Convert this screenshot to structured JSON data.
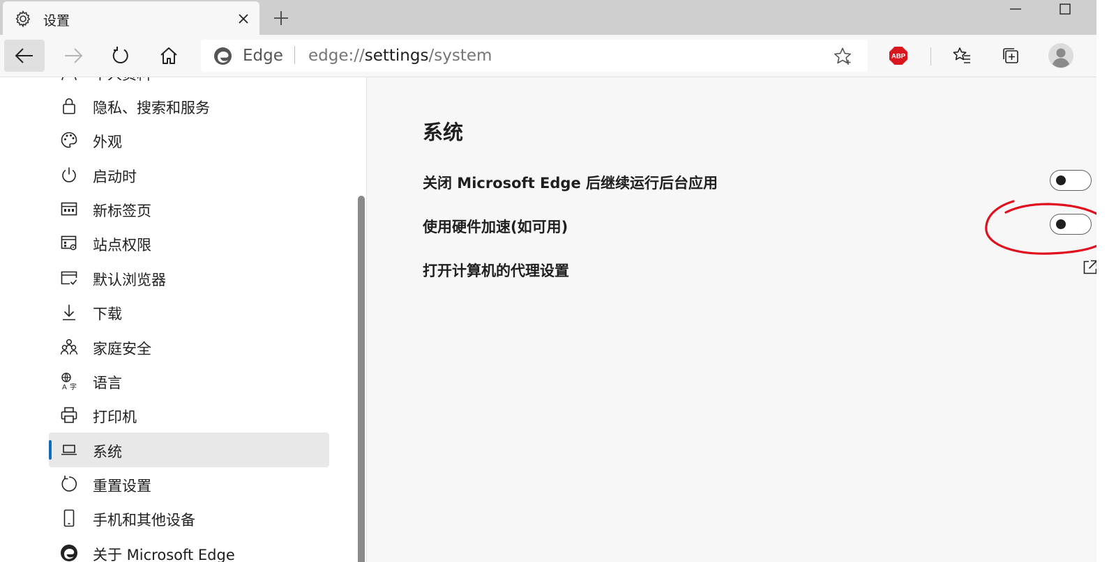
{
  "tab": {
    "title": "设置"
  },
  "address": {
    "site_name": "Edge",
    "url_prefix": "edge://",
    "url_highlight": "settings",
    "url_suffix": "/system"
  },
  "sidebar": {
    "items": [
      {
        "label": "个人资料",
        "icon": "person-icon",
        "selected": false
      },
      {
        "label": "隐私、搜索和服务",
        "icon": "lock-icon",
        "selected": false
      },
      {
        "label": "外观",
        "icon": "palette-icon",
        "selected": false
      },
      {
        "label": "启动时",
        "icon": "power-icon",
        "selected": false
      },
      {
        "label": "新标签页",
        "icon": "new-tab-page-icon",
        "selected": false
      },
      {
        "label": "站点权限",
        "icon": "site-permissions-icon",
        "selected": false
      },
      {
        "label": "默认浏览器",
        "icon": "default-browser-icon",
        "selected": false
      },
      {
        "label": "下载",
        "icon": "download-icon",
        "selected": false
      },
      {
        "label": "家庭安全",
        "icon": "family-icon",
        "selected": false
      },
      {
        "label": "语言",
        "icon": "language-icon",
        "selected": false
      },
      {
        "label": "打印机",
        "icon": "printer-icon",
        "selected": false
      },
      {
        "label": "系统",
        "icon": "laptop-icon",
        "selected": true
      },
      {
        "label": "重置设置",
        "icon": "reset-icon",
        "selected": false
      },
      {
        "label": "手机和其他设备",
        "icon": "phone-icon",
        "selected": false
      },
      {
        "label": "关于 Microsoft Edge",
        "icon": "edge-logo-icon",
        "selected": false
      }
    ]
  },
  "main": {
    "title": "系统",
    "settings": [
      {
        "label": "关闭 Microsoft Edge 后继续运行后台应用",
        "control": "toggle",
        "state": "off"
      },
      {
        "label": "使用硬件加速(如可用)",
        "control": "toggle",
        "state": "off",
        "annotated": true
      },
      {
        "label": "打开计算机的代理设置",
        "control": "external-link"
      }
    ]
  },
  "colors": {
    "accent": "#0f6cbd",
    "annotation": "#e0101e",
    "abp_badge": "#d9161e"
  }
}
